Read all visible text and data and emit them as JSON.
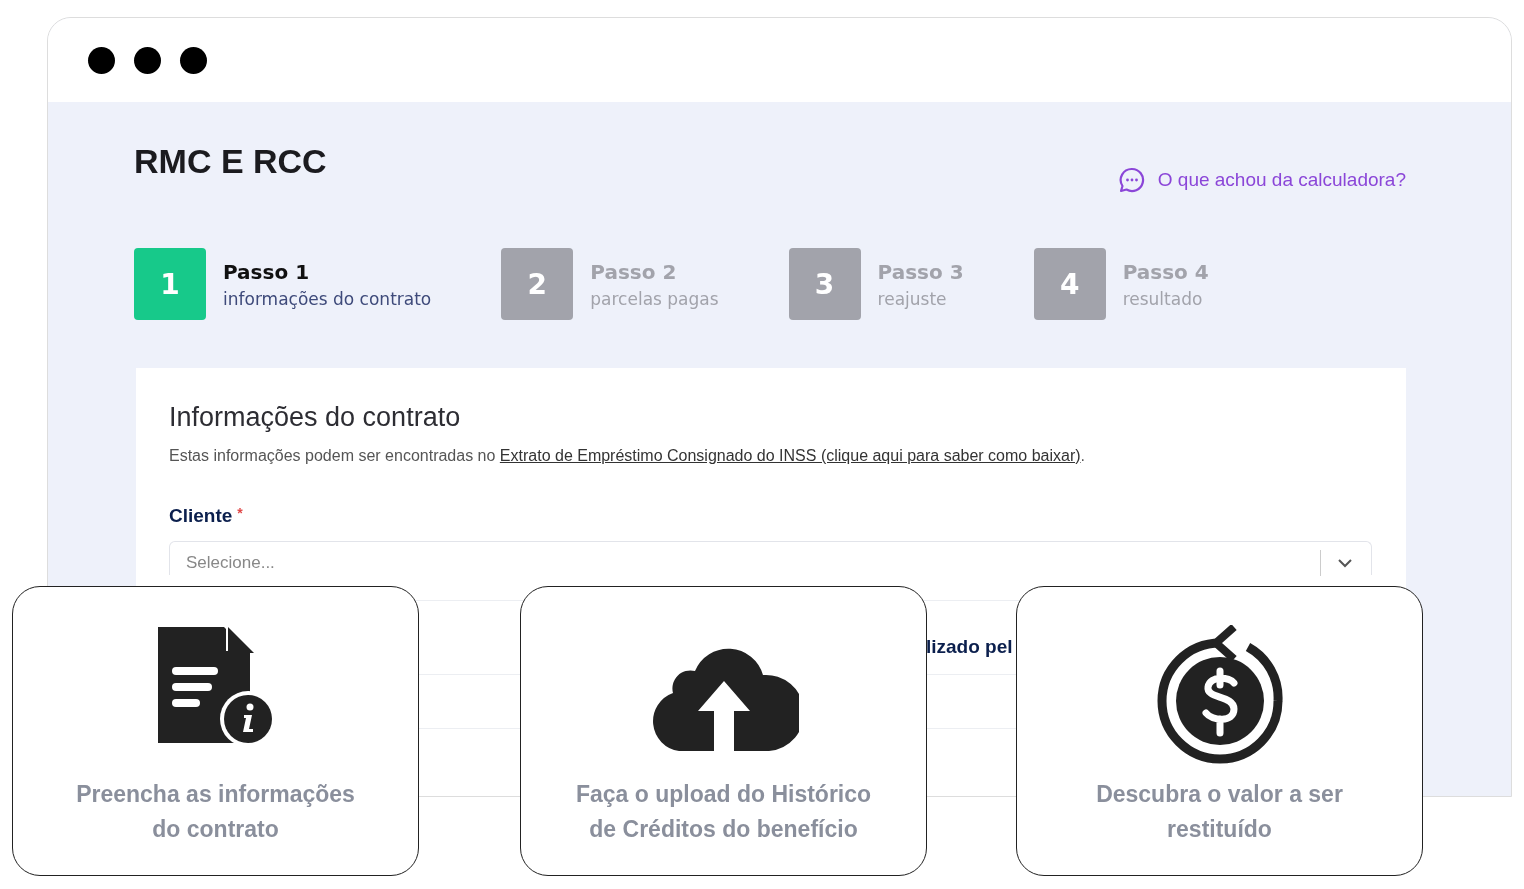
{
  "page": {
    "title": "RMC E RCC",
    "feedback_link": "O que achou da calculadora?"
  },
  "steps": [
    {
      "number": "1",
      "title": "Passo 1",
      "subtitle": "informações do contrato",
      "selected": true
    },
    {
      "number": "2",
      "title": "Passo 2",
      "subtitle": "parcelas pagas",
      "selected": false
    },
    {
      "number": "3",
      "title": "Passo 3",
      "subtitle": "reajuste",
      "selected": false
    },
    {
      "number": "4",
      "title": "Passo 4",
      "subtitle": "resultado",
      "selected": false
    }
  ],
  "form": {
    "heading": "Informações do contrato",
    "description": "Estas informações podem ser encontradas no ",
    "description_link": "Extrato de Empréstimo Consignado do INSS (clique aqui para saber como baixar)",
    "description_end": ".",
    "field_label": "Cliente",
    "required_mark": "*",
    "field_placeholder": "Selecione...",
    "hidden_label_fragment": "lizado pel"
  },
  "feature_cards": [
    {
      "kind": "document",
      "text": "Preencha as informações do contrato"
    },
    {
      "kind": "upload",
      "text": "Faça o upload do Histórico de Créditos do benefício"
    },
    {
      "kind": "dollar",
      "text": "Descubra o valor a ser restituído"
    }
  ]
}
